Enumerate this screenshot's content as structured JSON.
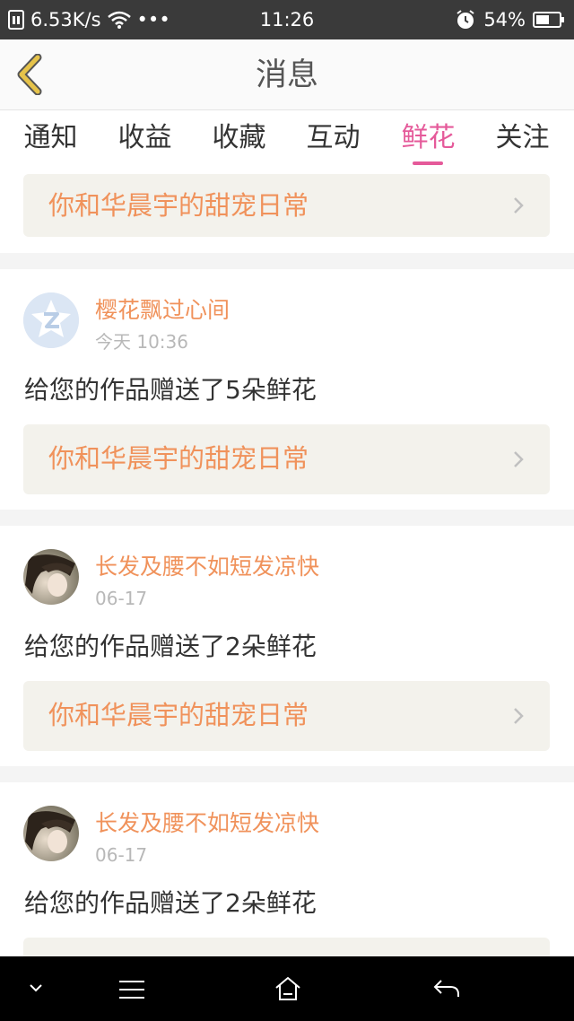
{
  "status_bar": {
    "network_speed": "6.53K/s",
    "more": "•••",
    "time": "11:26",
    "battery": "54%",
    "icons": [
      "sim-icon",
      "wifi-icon",
      "alarm-icon",
      "battery-icon"
    ]
  },
  "header": {
    "title": "消息",
    "back_icon": "chevron-left-icon"
  },
  "tabs": [
    {
      "label": "通知",
      "active": false
    },
    {
      "label": "收益",
      "active": false
    },
    {
      "label": "收藏",
      "active": false
    },
    {
      "label": "互动",
      "active": false
    },
    {
      "label": "鲜花",
      "active": true
    },
    {
      "label": "关注",
      "active": false
    }
  ],
  "feed": [
    {
      "partial": true,
      "work_title": "你和华晨宇的甜宠日常"
    },
    {
      "user": "樱花飘过心间",
      "time": "今天 10:36",
      "avatar": "default-avatar-icon",
      "message": "给您的作品赠送了5朵鲜花",
      "work_title": "你和华晨宇的甜宠日常"
    },
    {
      "user": "长发及腰不如短发凉快",
      "time": "06-17",
      "avatar": "photo-avatar",
      "message": "给您的作品赠送了2朵鲜花",
      "work_title": "你和华晨宇的甜宠日常"
    },
    {
      "user": "长发及腰不如短发凉快",
      "time": "06-17",
      "avatar": "photo-avatar",
      "message": "给您的作品赠送了2朵鲜花",
      "work_title": ""
    }
  ],
  "colors": {
    "accent": "#e55a9a",
    "orange": "#f0925b",
    "back_icon": "#e6c34a",
    "status_bar": "#3a3a3a"
  },
  "nav_bar_icons": [
    "chevron-down-icon",
    "menu-icon",
    "home-icon",
    "back-icon"
  ]
}
